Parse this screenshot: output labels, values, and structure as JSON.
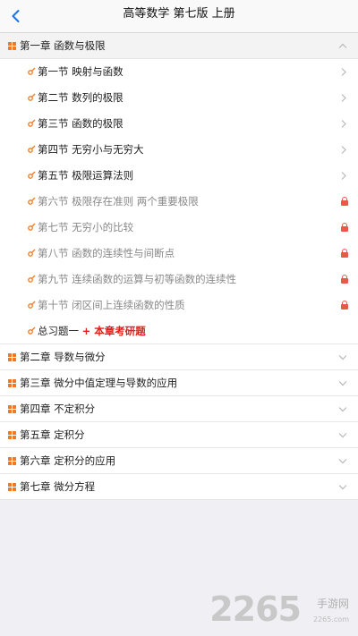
{
  "nav": {
    "back_icon": "chevron-left-icon",
    "title": "高等数学 第七版 上册"
  },
  "chapters": [
    {
      "label": "第一章 函数与极限",
      "expanded": true,
      "sections": [
        {
          "label": "第一节 映射与函数",
          "locked": false
        },
        {
          "label": "第二节 数列的极限",
          "locked": false
        },
        {
          "label": "第三节 函数的极限",
          "locked": false
        },
        {
          "label": "第四节 无穷小与无穷大",
          "locked": false
        },
        {
          "label": "第五节 极限运算法则",
          "locked": false
        },
        {
          "label": "第六节 极限存在准则 两个重要极限",
          "locked": true
        },
        {
          "label": "第七节 无穷小的比较",
          "locked": true
        },
        {
          "label": "第八节 函数的连续性与间断点",
          "locked": true
        },
        {
          "label": "第九节 连续函数的运算与初等函数的连续性",
          "locked": true
        },
        {
          "label": "第十节 闭区间上连续函数的性质",
          "locked": true
        }
      ],
      "summary": {
        "label": "总习题一",
        "extra": "+ 本章考研题"
      }
    },
    {
      "label": "第二章 导数与微分",
      "expanded": false
    },
    {
      "label": "第三章 微分中值定理与导数的应用",
      "expanded": false
    },
    {
      "label": "第四章 不定积分",
      "expanded": false
    },
    {
      "label": "第五章 定积分",
      "expanded": false
    },
    {
      "label": "第六章 定积分的应用",
      "expanded": false
    },
    {
      "label": "第七章 微分方程",
      "expanded": false
    }
  ],
  "watermark": {
    "number": "2265",
    "text": "手游网",
    "sub": "2265.com"
  },
  "colors": {
    "accent": "#f07a24",
    "lock": "#e65a4a",
    "extra": "#e0201b",
    "nav_tint": "#1a73e8"
  }
}
